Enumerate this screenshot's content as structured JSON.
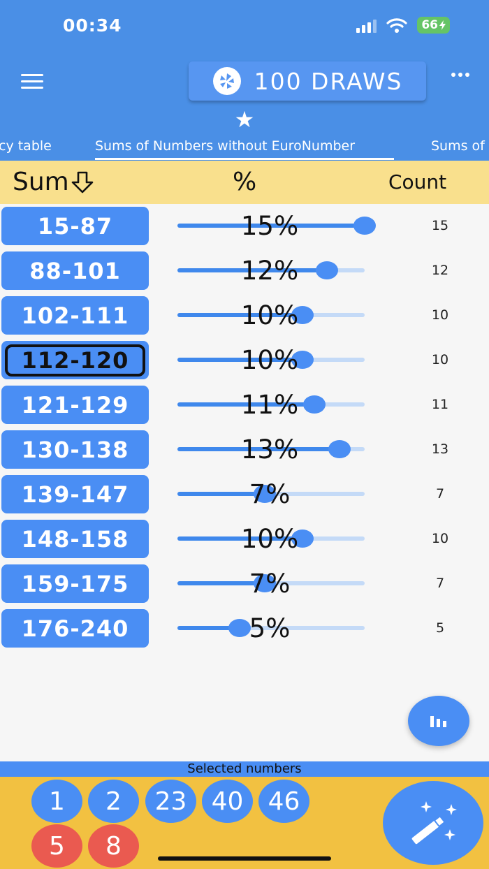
{
  "status": {
    "time": "00:34",
    "battery": "66"
  },
  "header": {
    "draws_label": "100 DRAWS",
    "star": "★"
  },
  "tabs": [
    {
      "label": "cy table"
    },
    {
      "label": "Sums of Numbers without EuroNumber"
    },
    {
      "label": "Sums of"
    }
  ],
  "table": {
    "headers": {
      "sum": "Sum",
      "pct": "%",
      "count": "Count"
    },
    "rows": [
      {
        "range": "15-87",
        "pct_label": "15%",
        "count": "15",
        "fill": 1.0
      },
      {
        "range": "88-101",
        "pct_label": "12%",
        "count": "12",
        "fill": 0.8
      },
      {
        "range": "102-111",
        "pct_label": "10%",
        "count": "10",
        "fill": 0.667
      },
      {
        "range": "112-120",
        "pct_label": "10%",
        "count": "10",
        "fill": 0.667,
        "selected": true
      },
      {
        "range": "121-129",
        "pct_label": "11%",
        "count": "11",
        "fill": 0.733
      },
      {
        "range": "130-138",
        "pct_label": "13%",
        "count": "13",
        "fill": 0.867
      },
      {
        "range": "139-147",
        "pct_label": "7%",
        "count": "7",
        "fill": 0.467
      },
      {
        "range": "148-158",
        "pct_label": "10%",
        "count": "10",
        "fill": 0.667
      },
      {
        "range": "159-175",
        "pct_label": "7%",
        "count": "7",
        "fill": 0.467
      },
      {
        "range": "176-240",
        "pct_label": "5%",
        "count": "5",
        "fill": 0.333
      }
    ]
  },
  "selected": {
    "title": "Selected numbers",
    "numbers": [
      "1",
      "2",
      "23",
      "40",
      "46"
    ],
    "euro_numbers": [
      "5",
      "8"
    ]
  },
  "colors": {
    "primary": "#4a8fe6",
    "button": "#4a8ef4",
    "header_bg": "#f9e08d",
    "panel_bg": "#f2c141",
    "euro_ball": "#ea5a50"
  }
}
